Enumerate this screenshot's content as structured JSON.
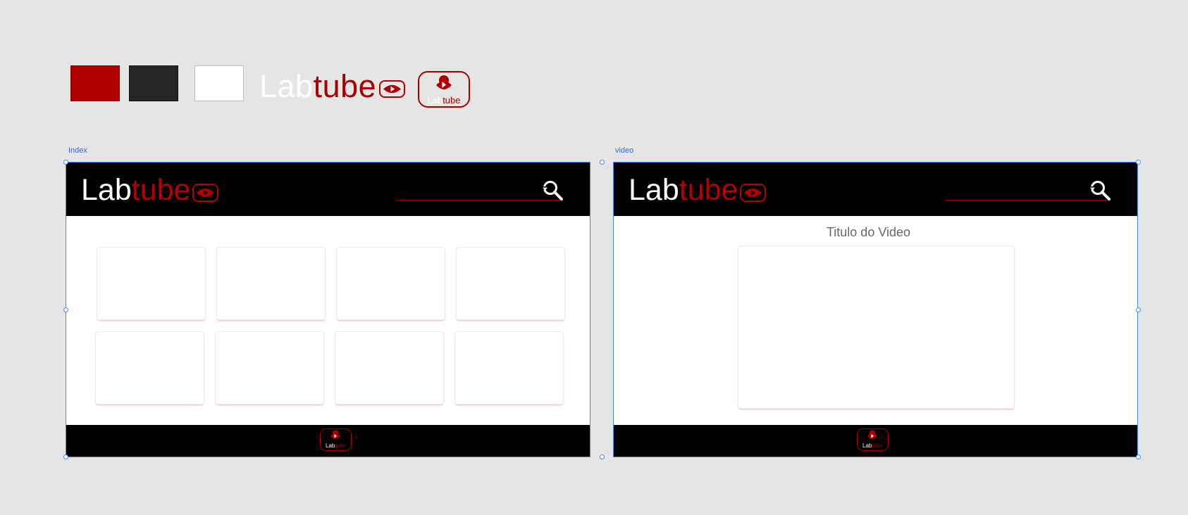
{
  "style_guide": {
    "colors": [
      "#b00000",
      "#262626",
      "#ffffff"
    ],
    "logo": {
      "lab": "Lab",
      "tube": "tube"
    },
    "app_icon": {
      "lab": "Lab",
      "tube": "tube"
    }
  },
  "frames": {
    "index": {
      "label": "Index",
      "logo": {
        "lab": "Lab",
        "tube": "tube"
      },
      "search_icon": "search-icon",
      "footer_icon": {
        "lab": "Lab",
        "tube": "tube"
      },
      "cards": 8
    },
    "video": {
      "label": "video",
      "logo": {
        "lab": "Lab",
        "tube": "tube"
      },
      "search_icon": "search-icon",
      "title": "Titulo do Video",
      "footer_icon": {
        "lab": "Lab",
        "tube": "tube"
      }
    }
  }
}
